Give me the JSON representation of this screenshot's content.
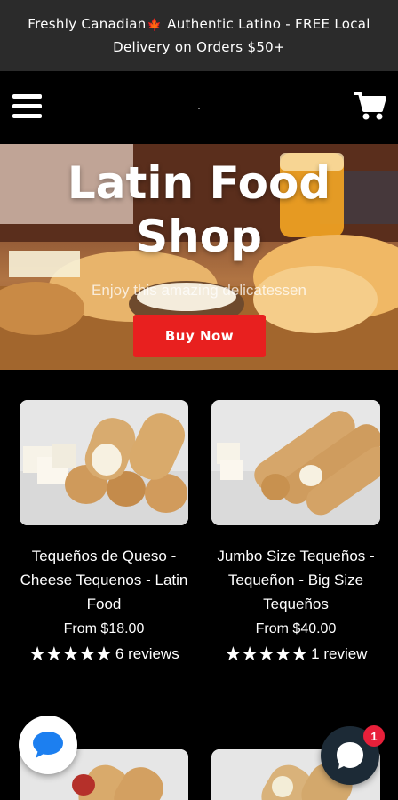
{
  "announcement": {
    "text_before": "Freshly Canadian",
    "text_after": " Authentic Latino - FREE Local Delivery on Orders $50+"
  },
  "header": {
    "menu_icon": "hamburger-menu-icon",
    "cart_icon": "shopping-cart-icon"
  },
  "hero": {
    "title_line1": "Latin Food",
    "title_line2": "Shop",
    "subtitle": "Enjoy this amazing delicatessen",
    "button_label": "Buy Now"
  },
  "products": [
    {
      "title": "Tequeños de Queso - Cheese Tequenos - Latin Food",
      "price": "From $18.00",
      "stars": "★★★★★",
      "reviews": "6 reviews"
    },
    {
      "title": "Jumbo Size Tequeños - Tequeñon - Big Size Tequeños",
      "price": "From $40.00",
      "stars": "★★★★★",
      "reviews": "1 review"
    }
  ],
  "chat": {
    "left_icon": "chat-bubble-icon",
    "right_icon": "message-icon",
    "badge_count": "1"
  },
  "colors": {
    "announcement_bg": "#2b2b2b",
    "buy_button": "#e8201f",
    "badge": "#e8203a"
  }
}
